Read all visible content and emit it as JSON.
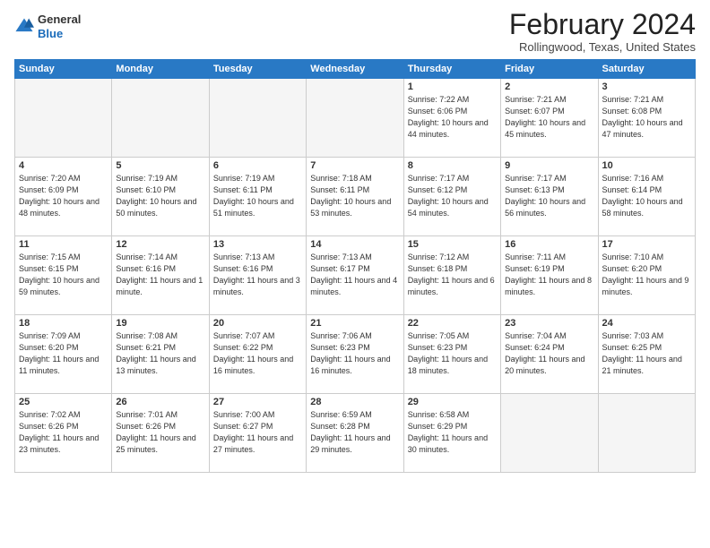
{
  "header": {
    "logo_general": "General",
    "logo_blue": "Blue",
    "month": "February 2024",
    "location": "Rollingwood, Texas, United States"
  },
  "weekdays": [
    "Sunday",
    "Monday",
    "Tuesday",
    "Wednesday",
    "Thursday",
    "Friday",
    "Saturday"
  ],
  "weeks": [
    [
      {
        "day": "",
        "info": ""
      },
      {
        "day": "",
        "info": ""
      },
      {
        "day": "",
        "info": ""
      },
      {
        "day": "",
        "info": ""
      },
      {
        "day": "1",
        "info": "Sunrise: 7:22 AM\nSunset: 6:06 PM\nDaylight: 10 hours\nand 44 minutes."
      },
      {
        "day": "2",
        "info": "Sunrise: 7:21 AM\nSunset: 6:07 PM\nDaylight: 10 hours\nand 45 minutes."
      },
      {
        "day": "3",
        "info": "Sunrise: 7:21 AM\nSunset: 6:08 PM\nDaylight: 10 hours\nand 47 minutes."
      }
    ],
    [
      {
        "day": "4",
        "info": "Sunrise: 7:20 AM\nSunset: 6:09 PM\nDaylight: 10 hours\nand 48 minutes."
      },
      {
        "day": "5",
        "info": "Sunrise: 7:19 AM\nSunset: 6:10 PM\nDaylight: 10 hours\nand 50 minutes."
      },
      {
        "day": "6",
        "info": "Sunrise: 7:19 AM\nSunset: 6:11 PM\nDaylight: 10 hours\nand 51 minutes."
      },
      {
        "day": "7",
        "info": "Sunrise: 7:18 AM\nSunset: 6:11 PM\nDaylight: 10 hours\nand 53 minutes."
      },
      {
        "day": "8",
        "info": "Sunrise: 7:17 AM\nSunset: 6:12 PM\nDaylight: 10 hours\nand 54 minutes."
      },
      {
        "day": "9",
        "info": "Sunrise: 7:17 AM\nSunset: 6:13 PM\nDaylight: 10 hours\nand 56 minutes."
      },
      {
        "day": "10",
        "info": "Sunrise: 7:16 AM\nSunset: 6:14 PM\nDaylight: 10 hours\nand 58 minutes."
      }
    ],
    [
      {
        "day": "11",
        "info": "Sunrise: 7:15 AM\nSunset: 6:15 PM\nDaylight: 10 hours\nand 59 minutes."
      },
      {
        "day": "12",
        "info": "Sunrise: 7:14 AM\nSunset: 6:16 PM\nDaylight: 11 hours\nand 1 minute."
      },
      {
        "day": "13",
        "info": "Sunrise: 7:13 AM\nSunset: 6:16 PM\nDaylight: 11 hours\nand 3 minutes."
      },
      {
        "day": "14",
        "info": "Sunrise: 7:13 AM\nSunset: 6:17 PM\nDaylight: 11 hours\nand 4 minutes."
      },
      {
        "day": "15",
        "info": "Sunrise: 7:12 AM\nSunset: 6:18 PM\nDaylight: 11 hours\nand 6 minutes."
      },
      {
        "day": "16",
        "info": "Sunrise: 7:11 AM\nSunset: 6:19 PM\nDaylight: 11 hours\nand 8 minutes."
      },
      {
        "day": "17",
        "info": "Sunrise: 7:10 AM\nSunset: 6:20 PM\nDaylight: 11 hours\nand 9 minutes."
      }
    ],
    [
      {
        "day": "18",
        "info": "Sunrise: 7:09 AM\nSunset: 6:20 PM\nDaylight: 11 hours\nand 11 minutes."
      },
      {
        "day": "19",
        "info": "Sunrise: 7:08 AM\nSunset: 6:21 PM\nDaylight: 11 hours\nand 13 minutes."
      },
      {
        "day": "20",
        "info": "Sunrise: 7:07 AM\nSunset: 6:22 PM\nDaylight: 11 hours\nand 16 minutes."
      },
      {
        "day": "21",
        "info": "Sunrise: 7:06 AM\nSunset: 6:23 PM\nDaylight: 11 hours\nand 16 minutes."
      },
      {
        "day": "22",
        "info": "Sunrise: 7:05 AM\nSunset: 6:23 PM\nDaylight: 11 hours\nand 18 minutes."
      },
      {
        "day": "23",
        "info": "Sunrise: 7:04 AM\nSunset: 6:24 PM\nDaylight: 11 hours\nand 20 minutes."
      },
      {
        "day": "24",
        "info": "Sunrise: 7:03 AM\nSunset: 6:25 PM\nDaylight: 11 hours\nand 21 minutes."
      }
    ],
    [
      {
        "day": "25",
        "info": "Sunrise: 7:02 AM\nSunset: 6:26 PM\nDaylight: 11 hours\nand 23 minutes."
      },
      {
        "day": "26",
        "info": "Sunrise: 7:01 AM\nSunset: 6:26 PM\nDaylight: 11 hours\nand 25 minutes."
      },
      {
        "day": "27",
        "info": "Sunrise: 7:00 AM\nSunset: 6:27 PM\nDaylight: 11 hours\nand 27 minutes."
      },
      {
        "day": "28",
        "info": "Sunrise: 6:59 AM\nSunset: 6:28 PM\nDaylight: 11 hours\nand 29 minutes."
      },
      {
        "day": "29",
        "info": "Sunrise: 6:58 AM\nSunset: 6:29 PM\nDaylight: 11 hours\nand 30 minutes."
      },
      {
        "day": "",
        "info": ""
      },
      {
        "day": "",
        "info": ""
      }
    ]
  ]
}
